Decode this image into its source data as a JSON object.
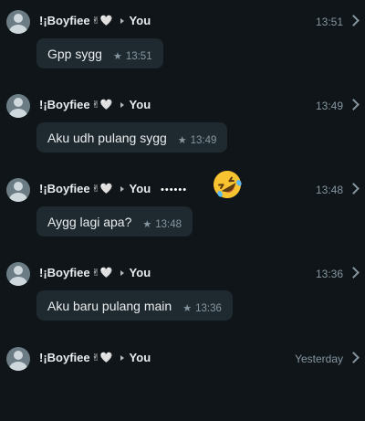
{
  "messages": [
    {
      "sender": "!¡Boyfiee",
      "sender_emoji": "✌🤍",
      "recipient": "You",
      "time": "13:51",
      "text": "Gpp sygg",
      "bubble_time": "13:51"
    },
    {
      "sender": "!¡Boyfiee",
      "sender_emoji": "✌🤍",
      "recipient": "You",
      "time": "13:49",
      "text": "Aku udh pulang sygg",
      "bubble_time": "13:49"
    },
    {
      "sender": "!¡Boyfiee",
      "sender_emoji": "✌🤍",
      "recipient": "You",
      "time": "13:48",
      "text": "Aygg lagi apa?",
      "bubble_time": "13:48"
    },
    {
      "sender": "!¡Boyfiee",
      "sender_emoji": "✌🤍",
      "recipient": "You",
      "time": "13:36",
      "text": "Aku baru pulang main",
      "bubble_time": "13:36"
    },
    {
      "sender": "!¡Boyfiee",
      "sender_emoji": "✌🤍",
      "recipient": "You",
      "time": "Yesterday"
    }
  ],
  "overlay": {
    "dots": "••••••",
    "emoji_name": "rolling-on-floor-laughing-icon"
  },
  "icons": {
    "star": "★",
    "chevron": "chevron-right-icon",
    "arrow": "play-arrow-icon",
    "avatar": "default-avatar-icon"
  },
  "colors": {
    "background": "#0f1519",
    "bubble": "#1f2a30",
    "muted": "#8696a0",
    "text": "#e9edef"
  }
}
